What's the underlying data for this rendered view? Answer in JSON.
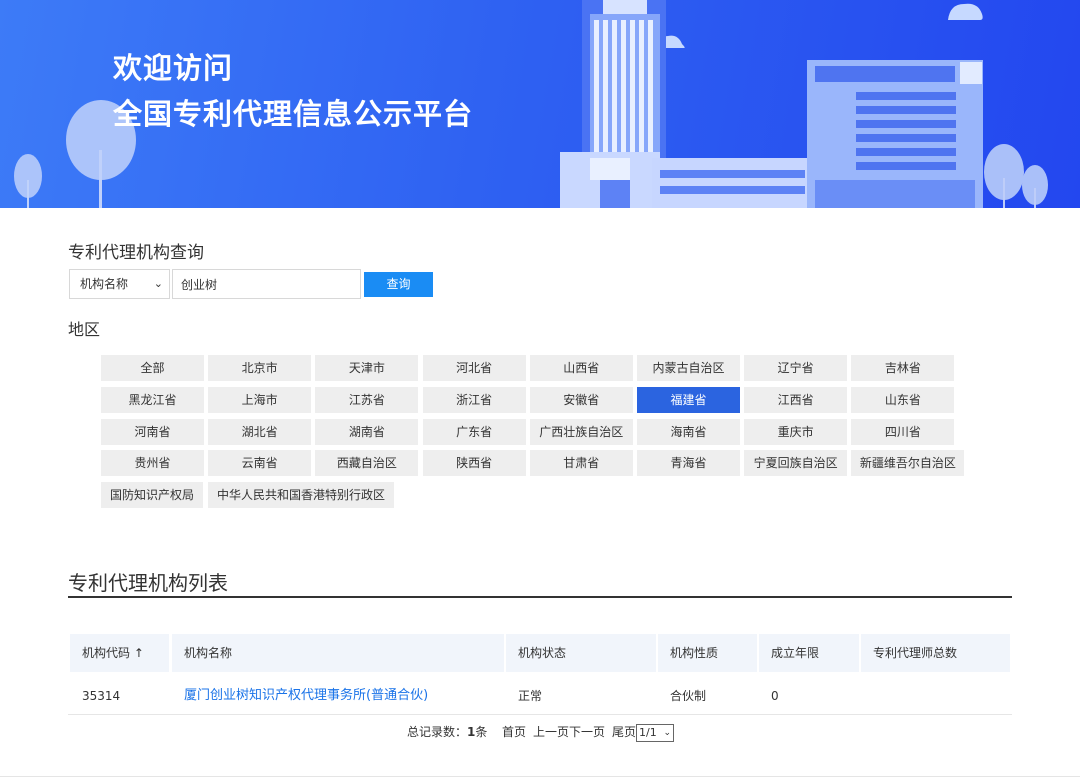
{
  "banner": {
    "line1": "欢迎访问",
    "line2": "全国专利代理信息公示平台"
  },
  "search": {
    "section_title": "专利代理机构查询",
    "type_selected": "机构名称",
    "input_value": "创业树",
    "button_label": "查询"
  },
  "region": {
    "title": "地区",
    "active": "福建省",
    "rows": [
      [
        "全部",
        "北京市",
        "天津市",
        "河北省",
        "山西省",
        "内蒙古自治区",
        "辽宁省",
        "吉林省"
      ],
      [
        "黑龙江省",
        "上海市",
        "江苏省",
        "浙江省",
        "安徽省",
        "福建省",
        "江西省",
        "山东省"
      ],
      [
        "河南省",
        "湖北省",
        "湖南省",
        "广东省",
        "广西壮族自治区",
        "海南省",
        "重庆市",
        "四川省"
      ],
      [
        "贵州省",
        "云南省",
        "西藏自治区",
        "陕西省",
        "甘肃省",
        "青海省",
        "宁夏回族自治区",
        "新疆维吾尔自治区"
      ],
      [
        "国防知识产权局",
        "中华人民共和国香港特别行政区"
      ]
    ]
  },
  "list": {
    "title": "专利代理机构列表",
    "columns": [
      "机构代码 ↑",
      "机构名称",
      "机构状态",
      "机构性质",
      "成立年限",
      "专利代理师总数"
    ],
    "rows": [
      [
        "35314",
        "厦门创业树知识产权代理事务所(普通合伙)",
        "正常",
        "合伙制",
        "0",
        ""
      ]
    ]
  },
  "pager": {
    "total_label": "总记录数：",
    "total_count": "1",
    "total_unit": "条",
    "first": "首页",
    "prev": "上一页",
    "next": "下一页",
    "last": "尾页",
    "page_selected": "1/1"
  },
  "colors": {
    "banner_start": "#3d7bf7",
    "banner_end": "#2347ef",
    "accent_button": "#1a8cf4",
    "active_region": "#2b64e0",
    "link": "#1a73e8"
  }
}
